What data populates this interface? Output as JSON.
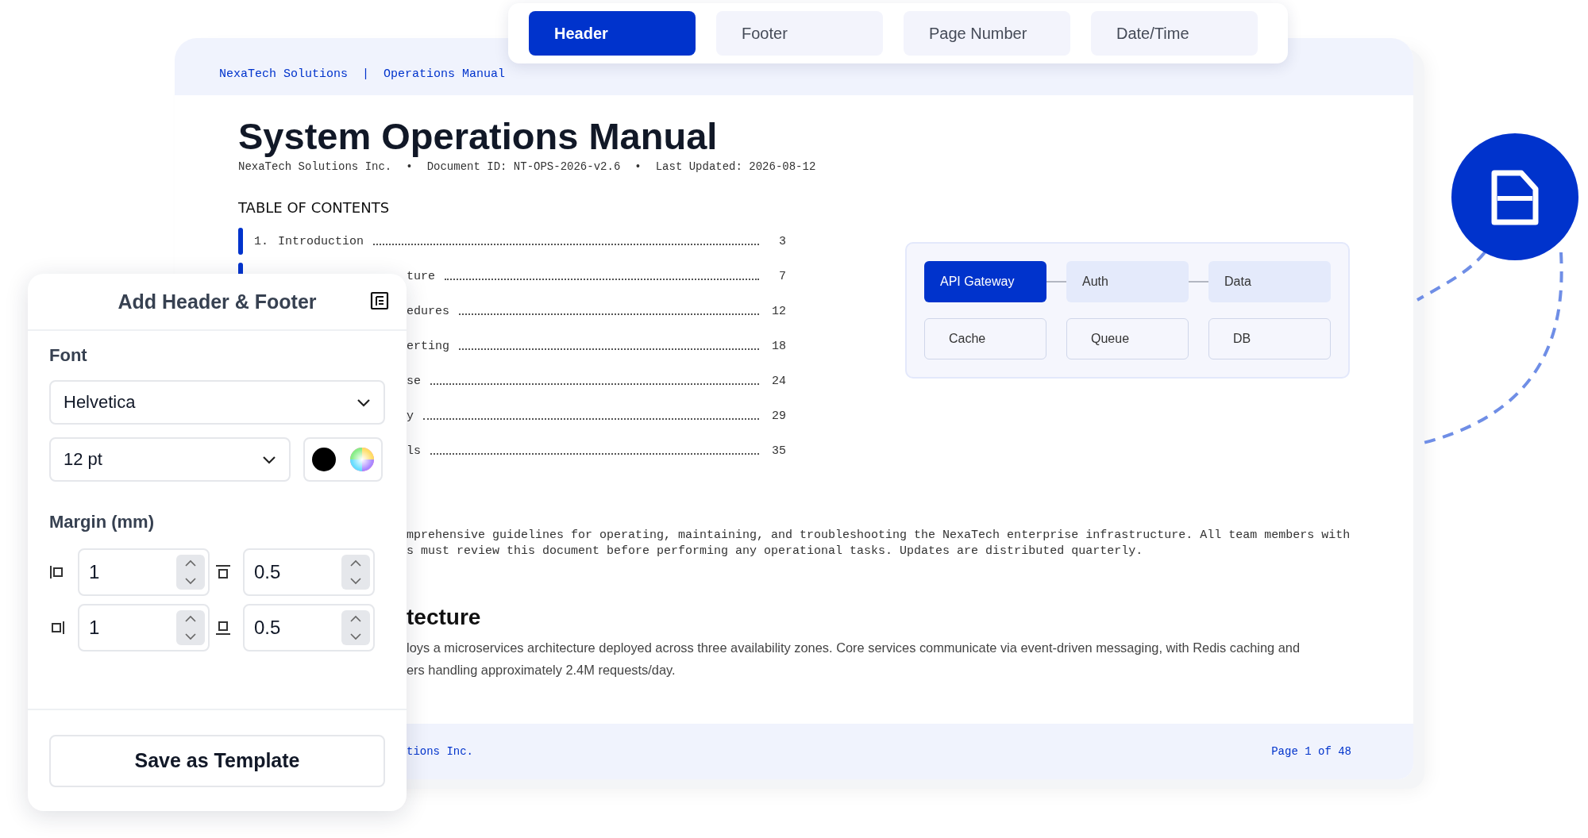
{
  "tabs": [
    {
      "label": "Header",
      "selected": true
    },
    {
      "label": "Footer",
      "selected": false
    },
    {
      "label": "Page Number",
      "selected": false
    },
    {
      "label": "Date/Time",
      "selected": false
    }
  ],
  "document": {
    "header": {
      "company": "NexaTech Solutions",
      "separator": "|",
      "title": "Operations Manual"
    },
    "title": "System Operations Manual",
    "meta": [
      "NexaTech Solutions Inc.",
      "•",
      "Document ID: NT-OPS-2026-v2.6",
      "•",
      "Last Updated: 2026-08-12"
    ],
    "toc": {
      "heading": "TABLE OF CONTENTS",
      "entries": [
        {
          "number": "1.",
          "title": "Introduction",
          "page": "3",
          "marked": true
        },
        {
          "title": "ture",
          "page": "7",
          "marked": true
        },
        {
          "title": "edures",
          "page": "12",
          "marked": false
        },
        {
          "title": "erting",
          "page": "18",
          "marked": false
        },
        {
          "title": "se",
          "page": "24",
          "marked": false
        },
        {
          "title": "y",
          "page": "29",
          "marked": false
        },
        {
          "title": "ls",
          "page": "35",
          "marked": false
        }
      ]
    },
    "diagram": {
      "nodes": [
        {
          "label": "API Gateway",
          "kind": "service",
          "selected": true
        },
        {
          "label": "Auth",
          "kind": "service",
          "selected": false
        },
        {
          "label": "Data",
          "kind": "service",
          "selected": false
        },
        {
          "label": "Cache",
          "kind": "store",
          "selected": false
        },
        {
          "label": "Queue",
          "kind": "store",
          "selected": false
        },
        {
          "label": "DB",
          "kind": "store",
          "selected": false
        }
      ]
    },
    "intro_lines": [
      "mprehensive guidelines for operating, maintaining, and troubleshooting the NexaTech enterprise infrastructure. All team members with",
      "s must review this document before performing any operational tasks. Updates are distributed quarterly."
    ],
    "section_heading": "tecture",
    "section_lines": [
      "loys a microservices architecture deployed across three availability zones. Core services communicate via event-driven messaging, with Redis caching and",
      "ers handling approximately 2.4M requests/day."
    ],
    "footer": {
      "left": "tions Inc.",
      "right": "Page 1 of 48"
    }
  },
  "panel": {
    "title": "Add Header & Footer",
    "font_label": "Font",
    "font": "Helvetica",
    "size": "12 pt",
    "margin_label": "Margin (mm)",
    "margins": [
      {
        "kind": "left",
        "value": "1"
      },
      {
        "kind": "top",
        "value": "0.5"
      },
      {
        "kind": "right",
        "value": "1"
      },
      {
        "kind": "bottom",
        "value": "0.5"
      }
    ],
    "save_button": "Save as Template"
  }
}
